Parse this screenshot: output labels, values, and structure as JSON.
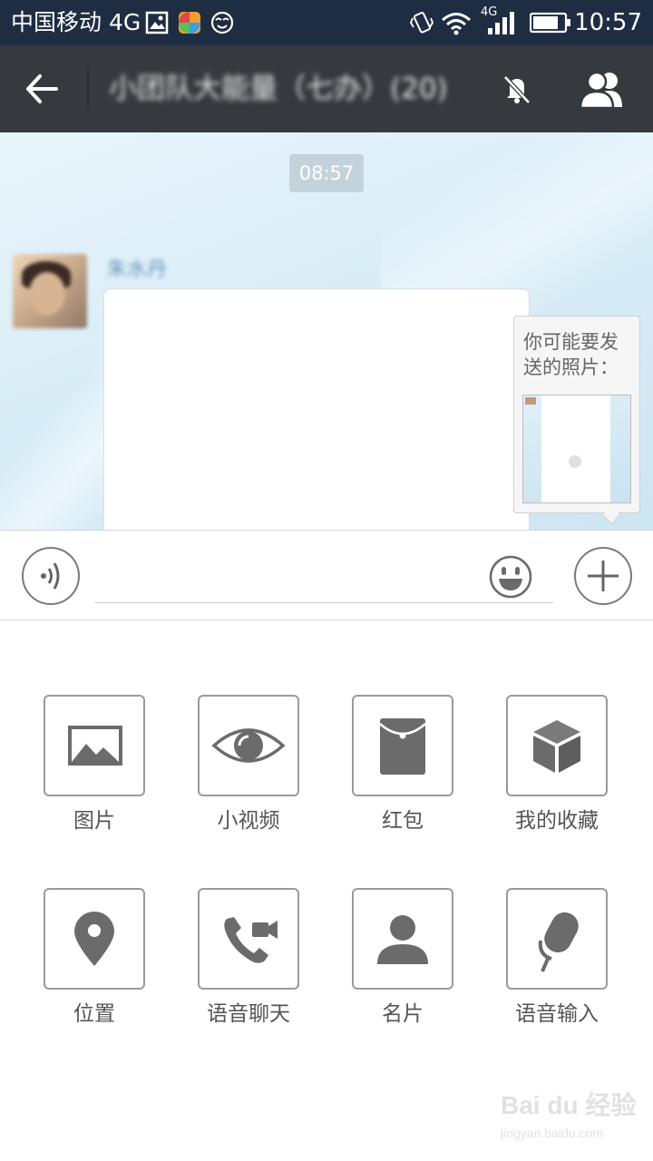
{
  "status_bar": {
    "carrier": "中国移动 4G",
    "network": "4G",
    "time": "10:57",
    "icons": [
      "image-notification-icon",
      "app-notification-icon",
      "smiley-notification-icon",
      "vibrate-icon",
      "wifi-icon",
      "cell-signal-icon",
      "battery-icon"
    ]
  },
  "header": {
    "title": "小团队大能量（七办）(20)",
    "back_icon": "arrow-left-icon",
    "mute_icon": "bell-off-icon",
    "members_icon": "group-icon"
  },
  "chat": {
    "timestamp": "08:57",
    "sender_name": "朱水丹",
    "suggestion": {
      "text": "你可能要发送的照片："
    }
  },
  "input_bar": {
    "value": "",
    "voice_icon": "voice-input-icon",
    "emoji_icon": "emoji-icon",
    "plus_icon": "plus-icon"
  },
  "panel": {
    "items": [
      {
        "label": "图片",
        "icon": "image-icon"
      },
      {
        "label": "小视频",
        "icon": "eye-icon"
      },
      {
        "label": "红包",
        "icon": "red-packet-icon"
      },
      {
        "label": "我的收藏",
        "icon": "cube-icon"
      },
      {
        "label": "位置",
        "icon": "location-pin-icon"
      },
      {
        "label": "语音聊天",
        "icon": "phone-video-icon"
      },
      {
        "label": "名片",
        "icon": "person-card-icon"
      },
      {
        "label": "语音输入",
        "icon": "microphone-icon"
      }
    ]
  },
  "watermark": {
    "brand": "Bai du 经验",
    "url": "jingyan.baidu.com"
  }
}
